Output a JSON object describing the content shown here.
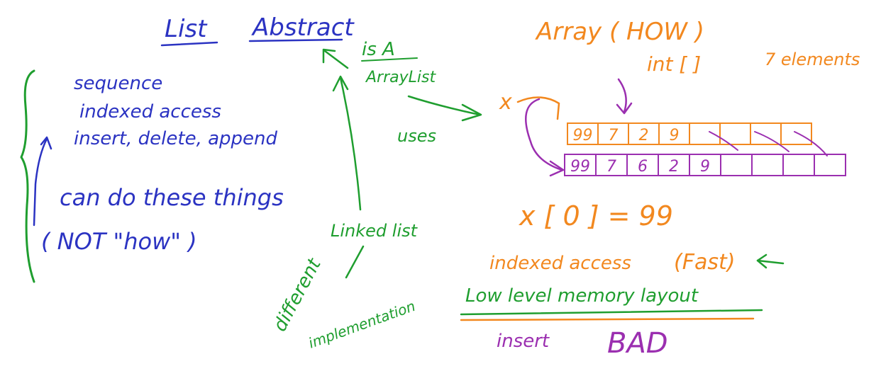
{
  "colors": {
    "blue": "#2b33c2",
    "green": "#1f9e2f",
    "orange": "#f2881f",
    "purple": "#9b2fb0",
    "background": "#ffffff"
  },
  "left": {
    "title_list": "List",
    "title_abstract": "Abstract",
    "line1": "sequence",
    "line2": "indexed access",
    "line3": "insert, delete, append",
    "line4": "can do these things",
    "line5": "( NOT \"how\" )"
  },
  "middle": {
    "is_a": "is A",
    "arraylist": "ArrayList",
    "uses": "uses",
    "linked_list": "Linked list",
    "different": "different",
    "implementation": "implementation"
  },
  "right": {
    "array_how": "Array ( HOW )",
    "int_decl": "int [ ]",
    "seven_elements": "7 elements",
    "x_label": "x",
    "orange_array_cells": [
      "99",
      "7",
      "2",
      "9",
      "",
      "",
      "",
      ""
    ],
    "purple_array_cells": [
      "99",
      "7",
      "6",
      "2",
      "9",
      "",
      "",
      "",
      ""
    ],
    "x_index_expr": "x [ 0 ] = 99",
    "indexed_access": "indexed access",
    "fast": "(Fast)",
    "low_level": "Low level memory layout",
    "insert": "insert",
    "bad": "BAD"
  }
}
